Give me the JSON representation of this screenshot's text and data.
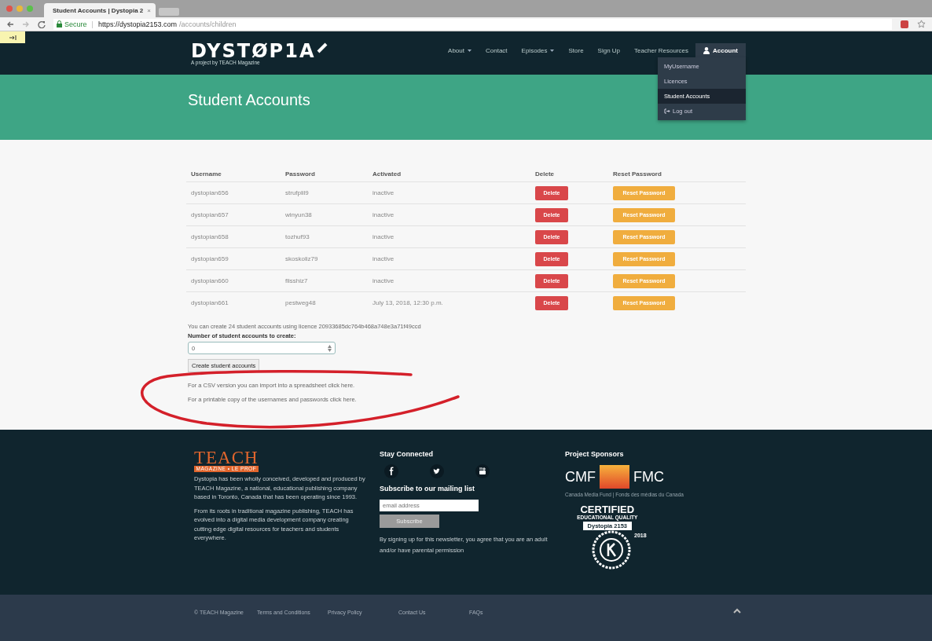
{
  "browser": {
    "tab_title": "Student Accounts | Dystopia 2",
    "tab_close": "×",
    "secure_label": "Secure",
    "url_separator": "|",
    "url_host": "https://dystopia2153.com",
    "url_path": "/accounts/children"
  },
  "nav": {
    "logo": "DYSTØP1A",
    "tagline": "A project by TEACH Magazine",
    "items": [
      {
        "label": "About",
        "dropdown": true,
        "selected": false
      },
      {
        "label": "Contact",
        "dropdown": false,
        "selected": false
      },
      {
        "label": "Episodes",
        "dropdown": true,
        "selected": false
      },
      {
        "label": "Store",
        "dropdown": false,
        "selected": false
      },
      {
        "label": "Sign Up",
        "dropdown": false,
        "selected": false
      },
      {
        "label": "Teacher Resources",
        "dropdown": false,
        "selected": false
      },
      {
        "label": "Account",
        "dropdown": false,
        "selected": true,
        "kind": "account"
      }
    ],
    "account_menu": [
      {
        "label": "MyUsername",
        "selected": false,
        "kind": "plain"
      },
      {
        "label": "Licences",
        "selected": false,
        "kind": "plain"
      },
      {
        "label": "Student Accounts",
        "selected": true,
        "kind": "plain"
      },
      {
        "label": "Log out",
        "selected": false,
        "kind": "logout"
      }
    ]
  },
  "banner": {
    "title": "Student Accounts"
  },
  "table": {
    "columns": [
      "Username",
      "Password",
      "Activated",
      "Delete",
      "Reset Password"
    ],
    "rows": [
      {
        "username": "dystopian656",
        "password": "strufplil9",
        "activated": "inactive",
        "delete": "Delete",
        "reset": "Reset Password"
      },
      {
        "username": "dystopian657",
        "password": "winyun38",
        "activated": "inactive",
        "delete": "Delete",
        "reset": "Reset Password"
      },
      {
        "username": "dystopian658",
        "password": "tozhuf93",
        "activated": "inactive",
        "delete": "Delete",
        "reset": "Reset Password"
      },
      {
        "username": "dystopian659",
        "password": "skoskoliz79",
        "activated": "inactive",
        "delete": "Delete",
        "reset": "Reset Password"
      },
      {
        "username": "dystopian660",
        "password": "flisshiz7",
        "activated": "inactive",
        "delete": "Delete",
        "reset": "Reset Password"
      },
      {
        "username": "dystopian661",
        "password": "pestweg48",
        "activated": "July 13, 2018, 12:30 p.m.",
        "delete": "Delete",
        "reset": "Reset Password"
      }
    ]
  },
  "create": {
    "info": "You can create 24 student accounts using licence 20933685dc764b468a748e3a71f49ccd",
    "label": "Number of student accounts to create:",
    "value": "0",
    "button": "Create student accounts"
  },
  "links": [
    "For a CSV version you can import into a spreadsheet click here.",
    "For a printable copy of the usernames and passwords click here."
  ],
  "footer": {
    "teach_logo": "TEACH",
    "teach_sub": "MAGAZINE • LE PROF",
    "about": [
      "Dystopia has been wholly conceived, developed and produced by TEACH Magazine, a national, educational publishing company based in Toronto, Canada that has been operating since 1993.",
      "From its roots in traditional magazine publishing, TEACH has evolved into a digital media development company creating cutting edge digital resources for teachers and students everywhere."
    ],
    "stay_connected": "Stay Connected",
    "subscribe_heading": "Subscribe to our mailing list",
    "email_placeholder": "email address",
    "subscribe_button": "Subscribe",
    "newsletter_note": "By signing up for this newsletter, you agree that you are an adult and/or have parental permission",
    "sponsors_heading": "Project Sponsors",
    "cmf": "CMF",
    "fmc": "FMC",
    "cmf_caption": "Canada Media Fund | Fonds des médias du Canada",
    "badge": {
      "title": "CERTIFIED",
      "subtitle": "EDUCATIONAL QUALITY",
      "ribbon": "Dystopia 2153",
      "year": "2018"
    }
  },
  "bottom_bar": {
    "links": [
      "© TEACH Magazine",
      "Terms and Conditions",
      "Privacy Policy",
      "Contact Us",
      "FAQs"
    ]
  }
}
